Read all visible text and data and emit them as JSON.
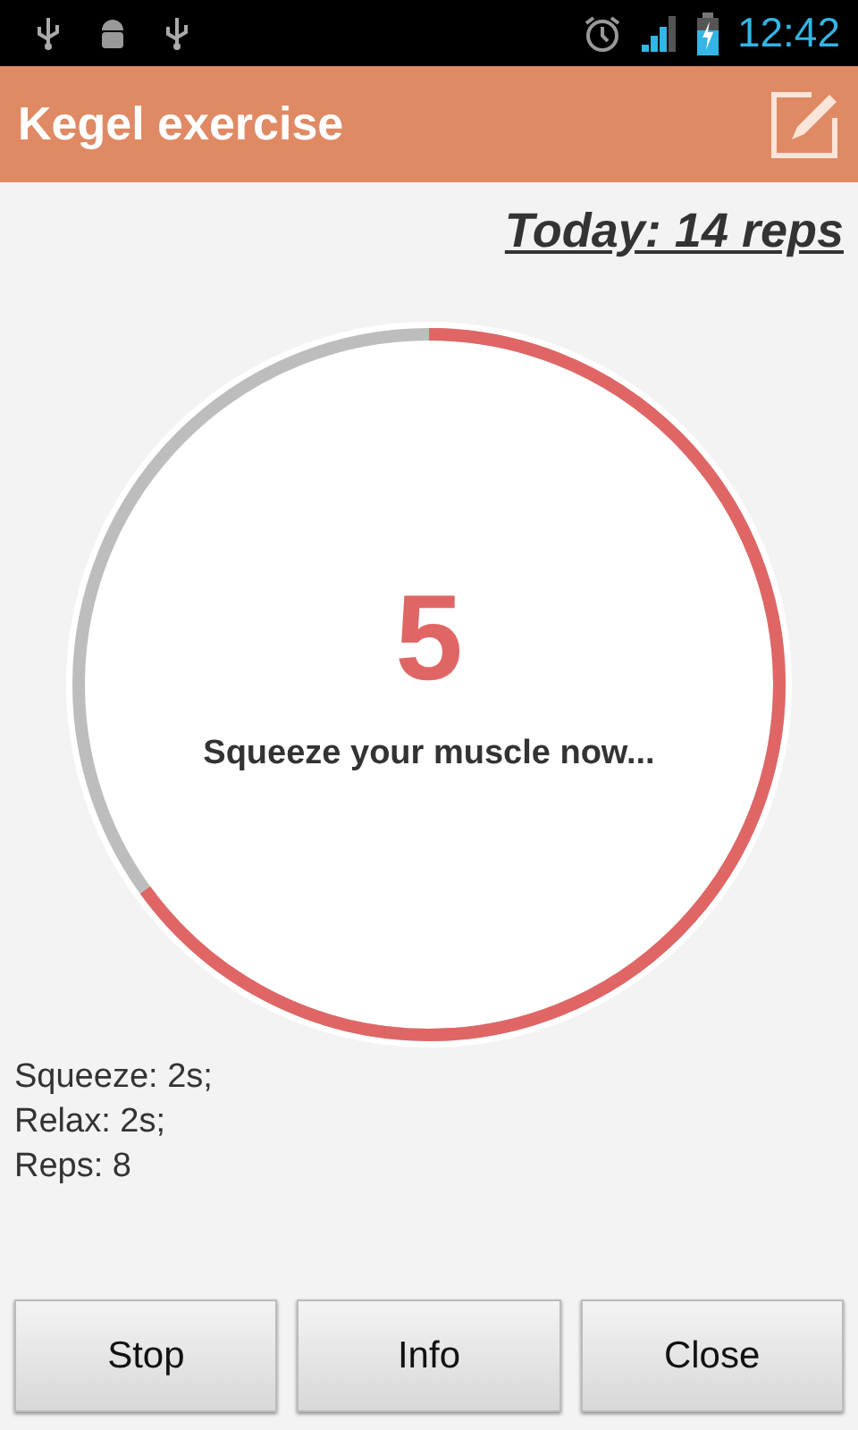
{
  "status_bar": {
    "time": "12:42"
  },
  "app_bar": {
    "title": "Kegel exercise"
  },
  "today": "Today: 14 reps",
  "timer": {
    "count": "5",
    "message": "Squeeze your muscle now...",
    "level": 0.65
  },
  "settings": [
    "Squeeze: 2s;",
    "Relax: 2s;",
    "Reps: 8"
  ],
  "buttons": [
    "Stop",
    "Info",
    "Close"
  ]
}
